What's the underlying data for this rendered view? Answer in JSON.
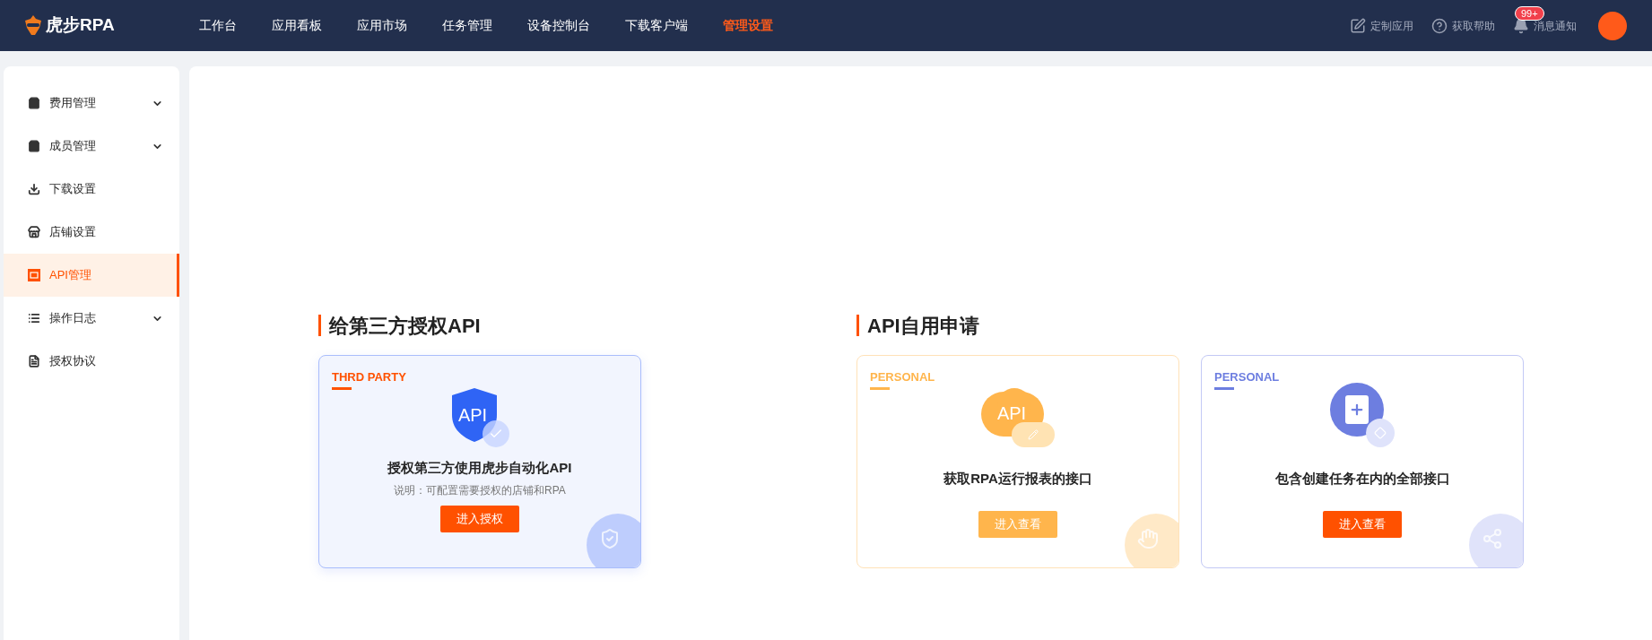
{
  "header": {
    "logo": "虎步RPA",
    "nav": [
      {
        "label": "工作台",
        "selected": false
      },
      {
        "label": "应用看板",
        "selected": false
      },
      {
        "label": "应用市场",
        "selected": false
      },
      {
        "label": "任务管理",
        "selected": false
      },
      {
        "label": "设备控制台",
        "selected": false
      },
      {
        "label": "下载客户端",
        "selected": false
      },
      {
        "label": "管理设置",
        "selected": true
      }
    ],
    "actions": [
      {
        "kind": "edit",
        "label": "定制应用"
      },
      {
        "kind": "help",
        "label": "获取帮助"
      },
      {
        "kind": "bell",
        "label": "消息通知",
        "badge": "99+"
      }
    ]
  },
  "sidebar": {
    "items": [
      {
        "kind": "group",
        "label": "费用管理",
        "selected": false
      },
      {
        "kind": "group",
        "label": "成员管理",
        "selected": false
      },
      {
        "kind": "link",
        "label": "下载设置",
        "selected": false
      },
      {
        "kind": "link",
        "label": "店铺设置",
        "selected": false
      },
      {
        "kind": "link",
        "label": "API管理",
        "selected": true
      },
      {
        "kind": "group",
        "label": "操作日志",
        "selected": false
      },
      {
        "kind": "link",
        "label": "授权协议",
        "selected": false
      }
    ]
  },
  "sections": [
    {
      "title": "给第三方授权API",
      "cards": [
        {
          "kind": "shield",
          "color": "#ff5100",
          "tag": "THRD PARTY",
          "icon_text": "API",
          "title": "授权第三方使用虎步自动化API",
          "description": "说明：可配置需要授权的店铺和RPA",
          "button": {
            "label": "进入授权",
            "disabled": false
          }
        }
      ]
    },
    {
      "title": "API自用申请",
      "cards": [
        {
          "kind": "cloud",
          "color": "#ffb54c",
          "tag": "PERSONAL",
          "icon_text": "API",
          "title": "获取RPA运行报表的接口",
          "button": {
            "label": "进入查看",
            "disabled": true
          }
        },
        {
          "kind": "document",
          "color": "#6d7ee0",
          "tag": "PERSONAL",
          "title": "包含创建任务在内的全部接口",
          "button": {
            "label": "进入查看",
            "disabled": false
          }
        }
      ]
    }
  ]
}
